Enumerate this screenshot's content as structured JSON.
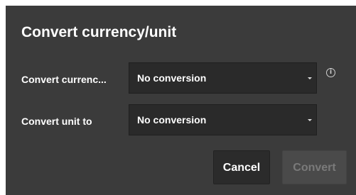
{
  "dialog": {
    "title": "Convert currency/unit",
    "currency_row": {
      "label": "Convert currenc...",
      "selected_value": "No conversion"
    },
    "unit_row": {
      "label": "Convert unit to",
      "selected_value": "No conversion"
    },
    "info_icon": "info-icon",
    "buttons": {
      "cancel_label": "Cancel",
      "convert_label": "Convert",
      "convert_disabled": true
    }
  },
  "colors": {
    "dialog_background": "#3b3b3b",
    "select_background": "#2a2a2a",
    "text_primary": "#ffffff",
    "text_disabled": "#7a7a7a"
  }
}
